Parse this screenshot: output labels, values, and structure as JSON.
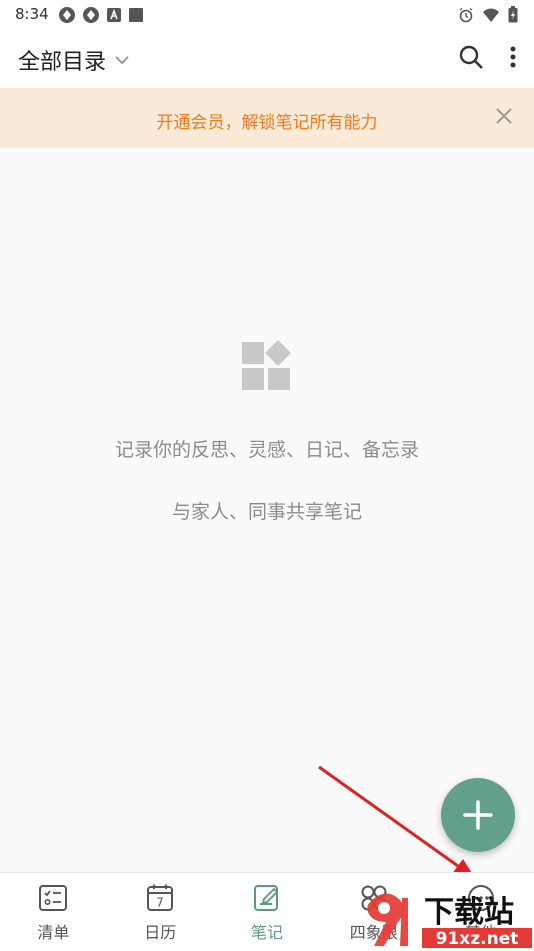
{
  "status_bar": {
    "time": "8:34"
  },
  "header": {
    "title": "全部目录"
  },
  "promo": {
    "text": "开通会员，解锁笔记所有能力"
  },
  "empty_state": {
    "line1": "记录你的反思、灵感、日记、备忘录",
    "line2": "与家人、同事共享笔记"
  },
  "calendar_day": "7",
  "nav": {
    "items": [
      {
        "label": "清单",
        "icon": "checklist-icon"
      },
      {
        "label": "日历",
        "icon": "calendar-icon"
      },
      {
        "label": "笔记",
        "icon": "note-edit-icon",
        "active": true
      },
      {
        "label": "四象限",
        "icon": "four-quadrant-icon"
      },
      {
        "label": "其他",
        "icon": "more-icon"
      }
    ]
  },
  "watermark": {
    "text1": "下载站",
    "text2": "91xz.net"
  },
  "colors": {
    "accent": "#62a08a",
    "promo_bg": "#fbead8",
    "promo_text": "#f07a1f",
    "arrow": "#e02020"
  }
}
